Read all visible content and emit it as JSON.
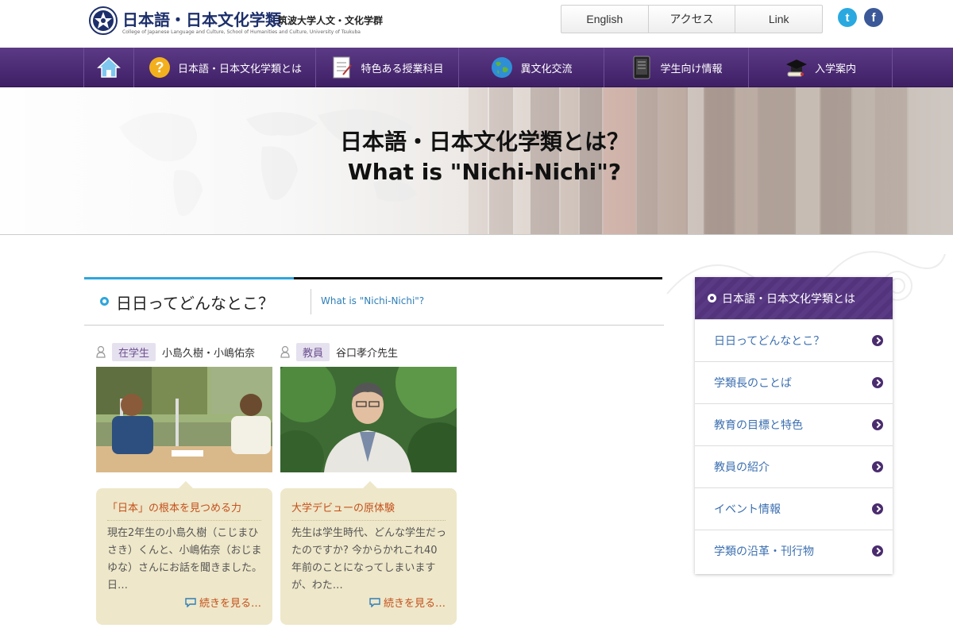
{
  "header": {
    "logo_title": "日本語・日本文化学類",
    "logo_sub": "筑波大学人文・文化学群",
    "logo_eng": "College of Japanese Language and Culture, School of Humanities and Culture, University of Tsukuba",
    "util_links": [
      "English",
      "アクセス",
      "Link"
    ],
    "twitter_label": "t",
    "facebook_label": "f",
    "colors": {
      "twitter": "#2aa9e0",
      "facebook": "#3b5998"
    }
  },
  "nav": {
    "items": [
      {
        "label": "",
        "icon": "home-icon"
      },
      {
        "label": "日本語・日本文化学類とは",
        "icon": "question-icon"
      },
      {
        "label": "特色ある授業科目",
        "icon": "document-icon"
      },
      {
        "label": "異文化交流",
        "icon": "globe-icon"
      },
      {
        "label": "学生向け情報",
        "icon": "tablet-icon"
      },
      {
        "label": "入学案内",
        "icon": "graduation-cap-icon"
      }
    ],
    "colors": {
      "background": "#4b2a72"
    }
  },
  "hero": {
    "title_ja": "日本語・日本文化学類とは？",
    "title_en": "What is \"Nichi-Nichi\"?"
  },
  "section": {
    "title": "日日ってどんなとこ？",
    "subtitle": "What is \"Nichi-Nichi\"?",
    "accent": "#2ea5de"
  },
  "cards": [
    {
      "tag": "在学生",
      "names": "小島久樹・小嶋佑奈",
      "heading": "「日本」の根本を見つめる力",
      "text": "現在2年生の小島久樹（こじまひさき）くんと、小嶋佑奈（おじまゆな）さんにお話を聞きました。 日…",
      "more": "続きを見る…"
    },
    {
      "tag": "教員",
      "names": "谷口孝介先生",
      "heading": "大学デビューの原体験",
      "text": "先生は学生時代、どんな学生だったのですか? 今からかれこれ40年前のことになってしまいますが、わた…",
      "more": "続きを見る…"
    }
  ],
  "sidebar": {
    "heading": "日本語・日本文化学類とは",
    "items": [
      "日日ってどんなとこ？",
      "学類長のことば",
      "教育の目標と特色",
      "教員の紹介",
      "イベント情報",
      "学類の沿革・刊行物"
    ]
  }
}
